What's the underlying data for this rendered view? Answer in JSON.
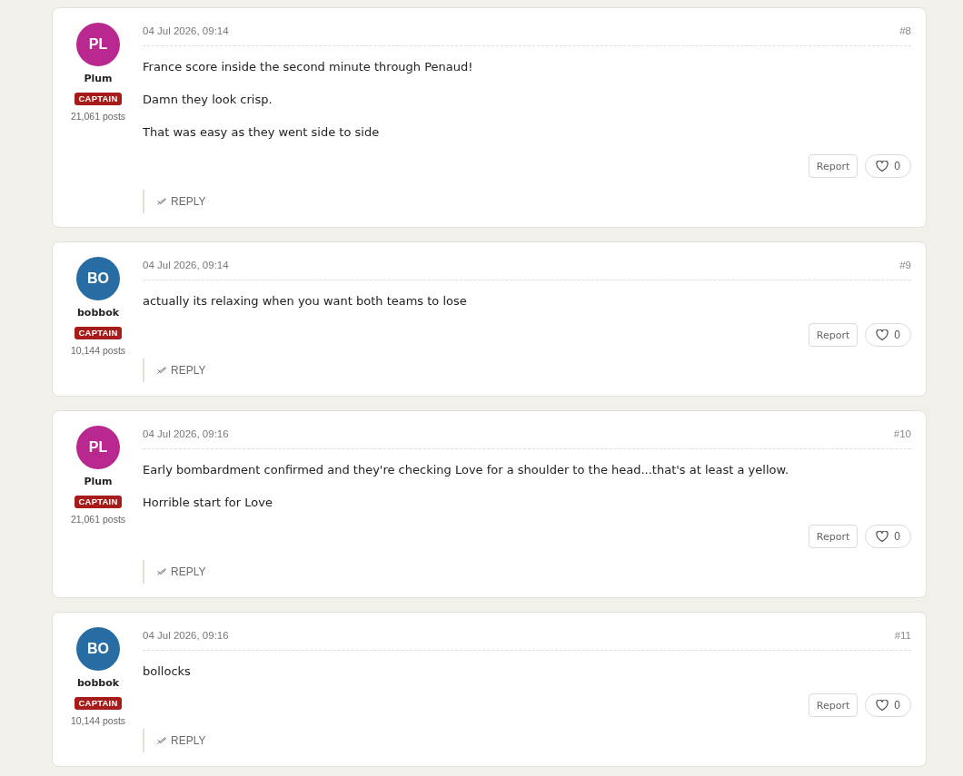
{
  "posts": [
    {
      "author": {
        "initials": "PL",
        "name": "Plum",
        "rank": "CAPTAIN",
        "post_count": "21,061 posts",
        "color": "#b8288f"
      },
      "date": "04 Jul 2026, 09:14",
      "number": "#8",
      "paragraphs": [
        "France score inside the second minute through Penaud!",
        "Damn they look crisp.",
        "That was easy as they went side to side"
      ],
      "report": "Report",
      "likes": "0",
      "liked": false,
      "reply": "REPLY"
    },
    {
      "author": {
        "initials": "BO",
        "name": "bobbok",
        "rank": "CAPTAIN",
        "post_count": "10,144 posts",
        "color": "#276ca3"
      },
      "date": "04 Jul 2026, 09:14",
      "number": "#9",
      "paragraphs": [
        "actually its relaxing when you want both teams to lose"
      ],
      "report": "Report",
      "likes": "0",
      "liked": false,
      "reply": "REPLY"
    },
    {
      "author": {
        "initials": "PL",
        "name": "Plum",
        "rank": "CAPTAIN",
        "post_count": "21,061 posts",
        "color": "#b8288f"
      },
      "date": "04 Jul 2026, 09:16",
      "number": "#10",
      "paragraphs": [
        "Early bombardment confirmed and they're checking Love for a shoulder to the head...that's at least a yellow.",
        "Horrible start for Love"
      ],
      "report": "Report",
      "likes": "0",
      "liked": false,
      "reply": "REPLY"
    },
    {
      "author": {
        "initials": "BO",
        "name": "bobbok",
        "rank": "CAPTAIN",
        "post_count": "10,144 posts",
        "color": "#276ca3"
      },
      "date": "04 Jul 2026, 09:16",
      "number": "#11",
      "paragraphs": [
        "bollocks"
      ],
      "report": "Report",
      "likes": "0",
      "liked": false,
      "reply": "REPLY"
    }
  ]
}
